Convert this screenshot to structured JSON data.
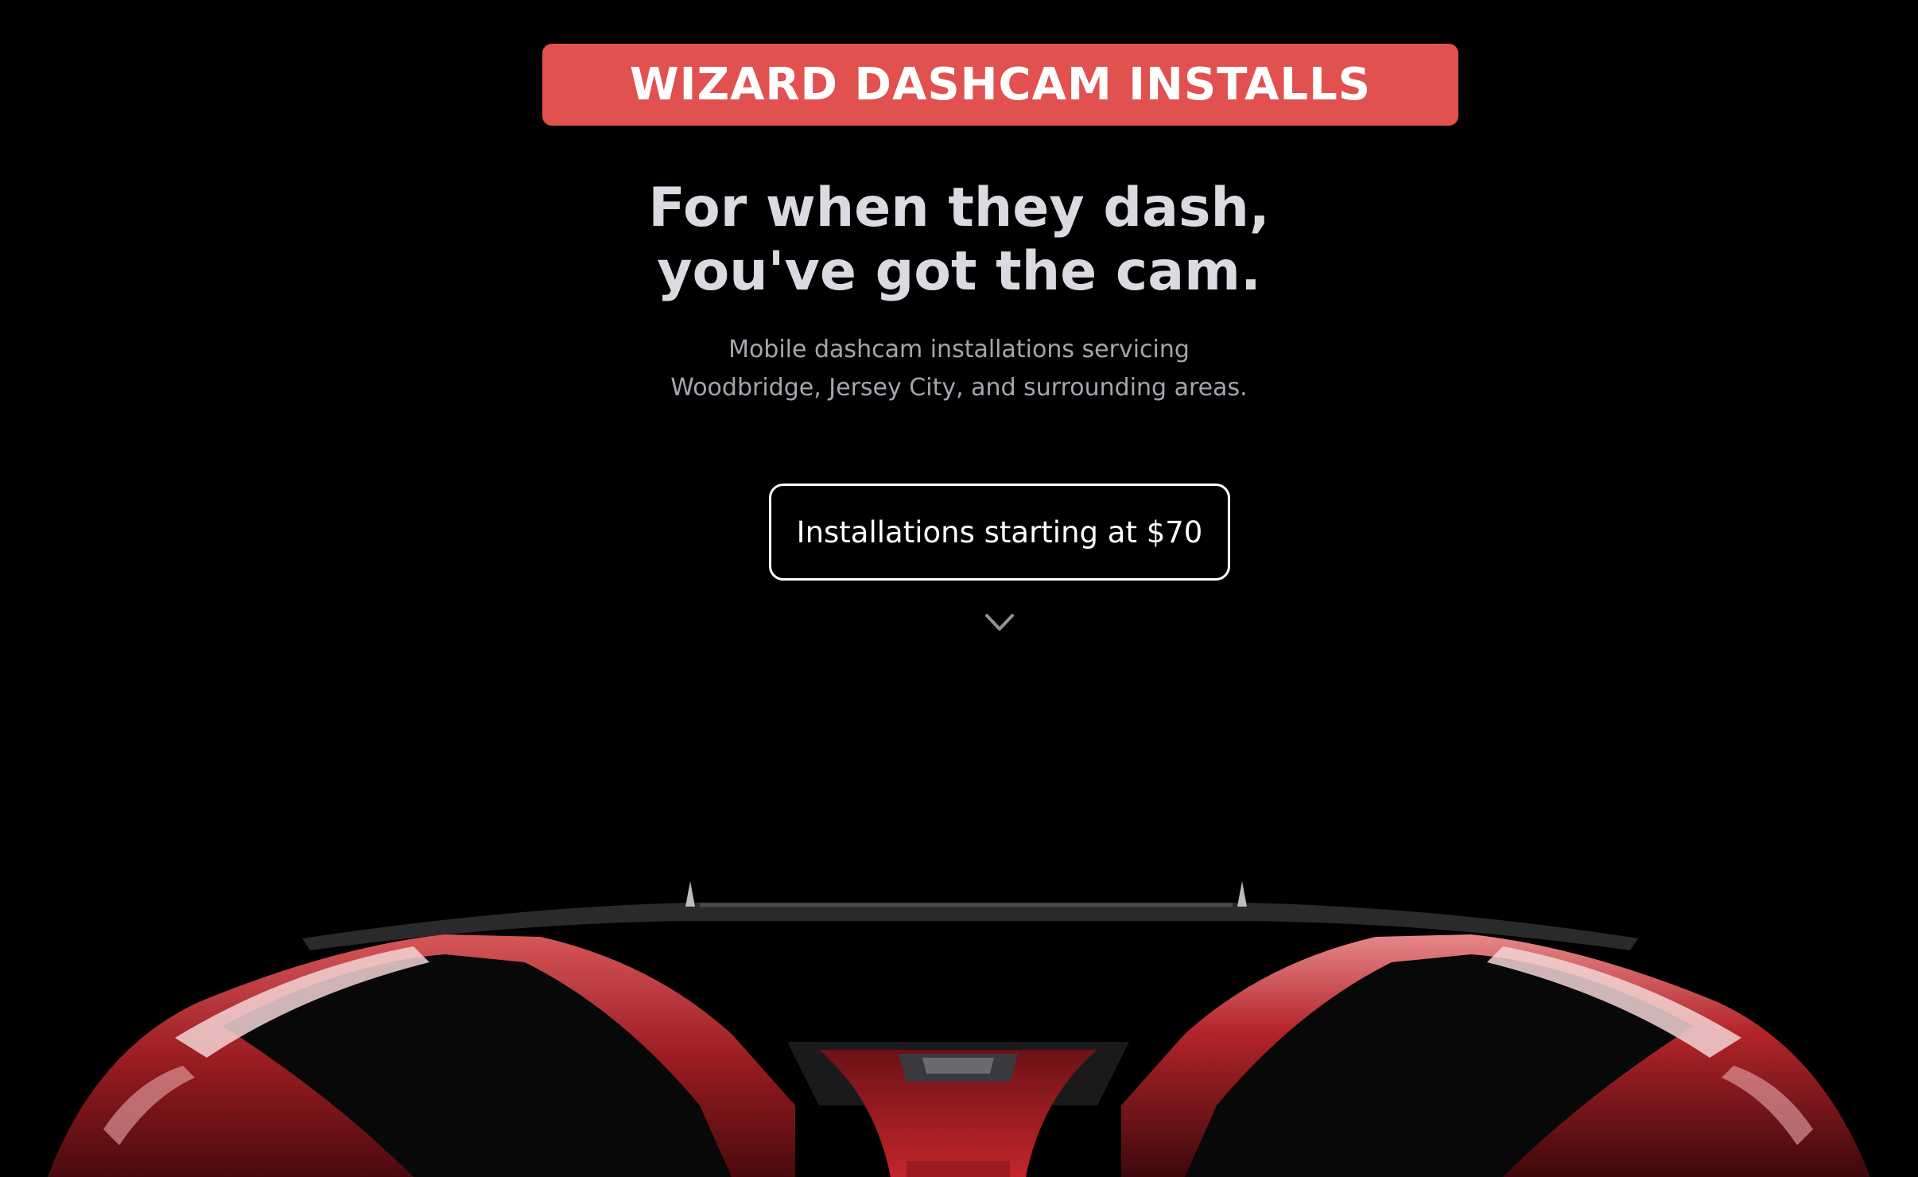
{
  "brand": {
    "title": "WIZARD DASHCAM INSTALLS",
    "color": "#e0514f"
  },
  "hero": {
    "headline_line1": "For when they dash,",
    "headline_line2": "you've got the cam.",
    "subtext_line1": "Mobile dashcam installations servicing",
    "subtext_line2": "Woodbridge, Jersey City, and surrounding areas.",
    "cta_label": "Installations starting at $70",
    "scroll_icon": "chevron-down-icon"
  },
  "colors": {
    "background": "#000000",
    "headline": "#d9dbe0",
    "subtext": "#a3a6ad",
    "car_red": "#b3252a"
  }
}
